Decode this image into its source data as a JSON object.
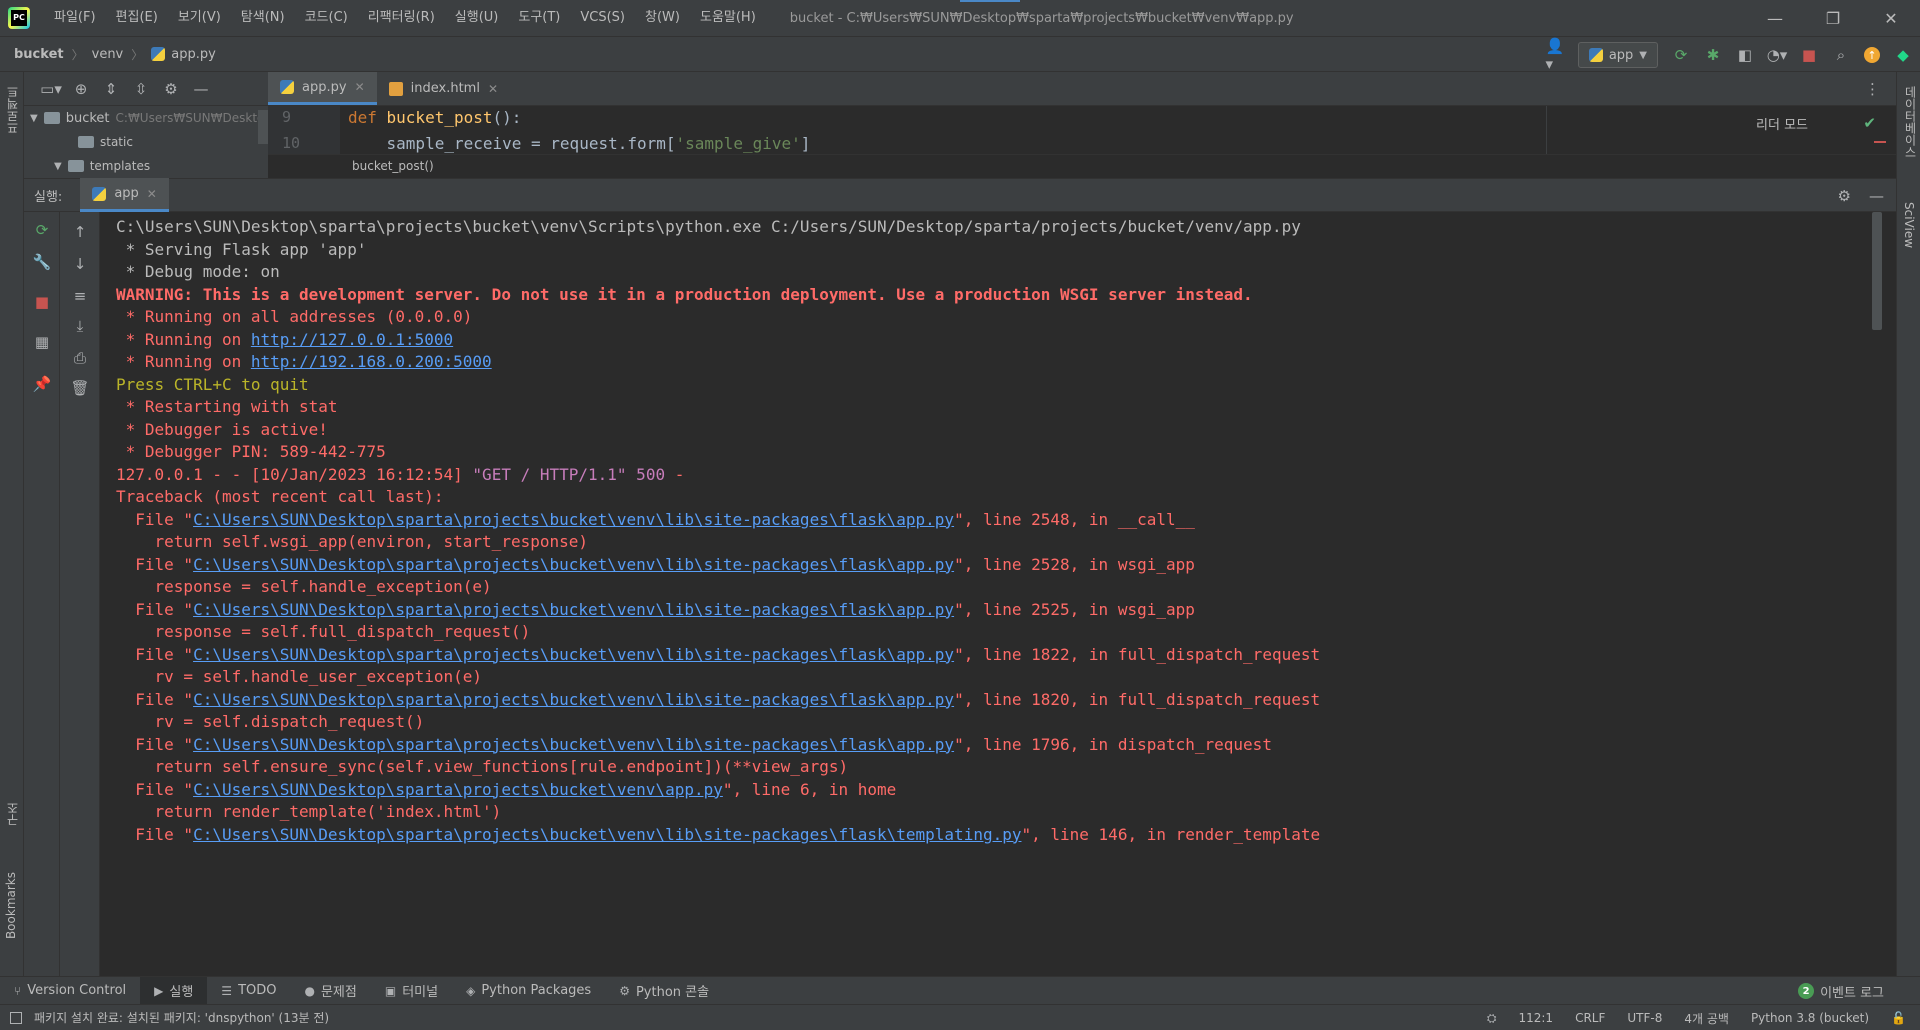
{
  "window": {
    "title": "bucket - C:₩Users₩SUN₩Desktop₩sparta₩projects₩bucket₩venv₩app.py",
    "minimize": "—",
    "restore": "❐",
    "close": "✕"
  },
  "menu": [
    "파일(F)",
    "편집(E)",
    "보기(V)",
    "탐색(N)",
    "코드(C)",
    "리팩터링(R)",
    "실행(U)",
    "도구(T)",
    "VCS(S)",
    "창(W)",
    "도움말(H)"
  ],
  "breadcrumb": {
    "project": "bucket",
    "folder": "venv",
    "file": "app.py"
  },
  "toolbar": {
    "run_config": "app"
  },
  "left_strip": {
    "project": "프로젝트",
    "structure": "구조",
    "bookmarks": "Bookmarks"
  },
  "right_strip": {
    "database": "데이터베이스",
    "sciview": "SciView"
  },
  "project_tree": {
    "root_name": "bucket",
    "root_path": "C:₩Users₩SUN₩Desktop₩",
    "items": [
      "static",
      "templates"
    ]
  },
  "editor": {
    "tabs": [
      {
        "label": "app.py",
        "active": true
      },
      {
        "label": "index.html",
        "active": false
      }
    ],
    "lines": [
      {
        "no": "9",
        "kw": "def ",
        "fn": "bucket_post",
        "rest": "():"
      },
      {
        "no": "10",
        "plain": "    sample_receive = request.form[",
        "str": "'sample_give'",
        "end": "]"
      }
    ],
    "reader_mode": "리더 모드",
    "breadcrumb": "bucket_post()"
  },
  "run_panel": {
    "title": "실행:",
    "tab": "app"
  },
  "console": {
    "lines": [
      {
        "style": "normal",
        "text": "C:\\Users\\SUN\\Desktop\\sparta\\projects\\bucket\\venv\\Scripts\\python.exe C:/Users/SUN/Desktop/sparta/projects/bucket/venv/app.py"
      },
      {
        "style": "normal",
        "text": " * Serving Flask app 'app'"
      },
      {
        "style": "normal",
        "text": " * Debug mode: on"
      },
      {
        "style": "red",
        "bold": true,
        "text": "WARNING: This is a development server. Do not use it in a production deployment. Use a production WSGI server instead."
      },
      {
        "style": "red",
        "text": " * Running on all addresses (0.0.0.0)"
      },
      {
        "style": "red",
        "pre": " * Running on ",
        "link": "http://127.0.0.1:5000",
        "post": ""
      },
      {
        "style": "red",
        "pre": " * Running on ",
        "link": "http://192.168.0.200:5000",
        "post": ""
      },
      {
        "style": "yellow",
        "text": "Press CTRL+C to quit"
      },
      {
        "style": "red",
        "text": " * Restarting with stat"
      },
      {
        "style": "red",
        "text": " * Debugger is active!"
      },
      {
        "style": "red",
        "text": " * Debugger PIN: 589-442-775"
      },
      {
        "style": "red",
        "pre": "127.0.0.1 - - [10/Jan/2023 16:12:54] ",
        "purple": "\"GET / HTTP/1.1\" 500",
        "post": " -"
      },
      {
        "style": "red",
        "text": "Traceback (most recent call last):"
      },
      {
        "style": "red",
        "pre": "  File \"",
        "link": "C:\\Users\\SUN\\Desktop\\sparta\\projects\\bucket\\venv\\lib\\site-packages\\flask\\app.py",
        "post": "\", line 2548, in __call__"
      },
      {
        "style": "red",
        "text": "    return self.wsgi_app(environ, start_response)"
      },
      {
        "style": "red",
        "pre": "  File \"",
        "link": "C:\\Users\\SUN\\Desktop\\sparta\\projects\\bucket\\venv\\lib\\site-packages\\flask\\app.py",
        "post": "\", line 2528, in wsgi_app"
      },
      {
        "style": "red",
        "text": "    response = self.handle_exception(e)"
      },
      {
        "style": "red",
        "pre": "  File \"",
        "link": "C:\\Users\\SUN\\Desktop\\sparta\\projects\\bucket\\venv\\lib\\site-packages\\flask\\app.py",
        "post": "\", line 2525, in wsgi_app"
      },
      {
        "style": "red",
        "text": "    response = self.full_dispatch_request()"
      },
      {
        "style": "red",
        "pre": "  File \"",
        "link": "C:\\Users\\SUN\\Desktop\\sparta\\projects\\bucket\\venv\\lib\\site-packages\\flask\\app.py",
        "post": "\", line 1822, in full_dispatch_request"
      },
      {
        "style": "red",
        "text": "    rv = self.handle_user_exception(e)"
      },
      {
        "style": "red",
        "pre": "  File \"",
        "link": "C:\\Users\\SUN\\Desktop\\sparta\\projects\\bucket\\venv\\lib\\site-packages\\flask\\app.py",
        "post": "\", line 1820, in full_dispatch_request"
      },
      {
        "style": "red",
        "text": "    rv = self.dispatch_request()"
      },
      {
        "style": "red",
        "pre": "  File \"",
        "link": "C:\\Users\\SUN\\Desktop\\sparta\\projects\\bucket\\venv\\lib\\site-packages\\flask\\app.py",
        "post": "\", line 1796, in dispatch_request"
      },
      {
        "style": "red",
        "text": "    return self.ensure_sync(self.view_functions[rule.endpoint])(**view_args)"
      },
      {
        "style": "red",
        "pre": "  File \"",
        "link": "C:\\Users\\SUN\\Desktop\\sparta\\projects\\bucket\\venv\\app.py",
        "post": "\", line 6, in home"
      },
      {
        "style": "red",
        "text": "    return render_template('index.html')"
      },
      {
        "style": "red",
        "pre": "  File \"",
        "link": "C:\\Users\\SUN\\Desktop\\sparta\\projects\\bucket\\venv\\lib\\site-packages\\flask\\templating.py",
        "post": "\", line 146, in render_template"
      }
    ]
  },
  "bottom_tools": [
    {
      "label": "Version Control",
      "icon": "branch-icon",
      "active": false
    },
    {
      "label": "실행",
      "icon": "run-icon",
      "active": true
    },
    {
      "label": "TODO",
      "icon": "list-icon",
      "active": false
    },
    {
      "label": "문제점",
      "icon": "problems-icon",
      "active": false
    },
    {
      "label": "터미널",
      "icon": "terminal-icon",
      "active": false
    },
    {
      "label": "Python Packages",
      "icon": "packages-icon",
      "active": false
    },
    {
      "label": "Python 콘솔",
      "icon": "python-console-icon",
      "active": false
    }
  ],
  "event_log": {
    "count": "2",
    "label": "이벤트 로그"
  },
  "status": {
    "message": "패키지 설치 완료: 설치된 패키지: 'dnspython' (13분 전)",
    "position": "112:1",
    "line_sep": "CRLF",
    "encoding": "UTF-8",
    "indent": "4개 공백",
    "interpreter": "Python 3.8 (bucket)"
  },
  "colors": {
    "accent": "#4a88c7",
    "console_red": "#ff6b68",
    "console_link": "#589df6",
    "console_yellow": "#bbb529"
  }
}
